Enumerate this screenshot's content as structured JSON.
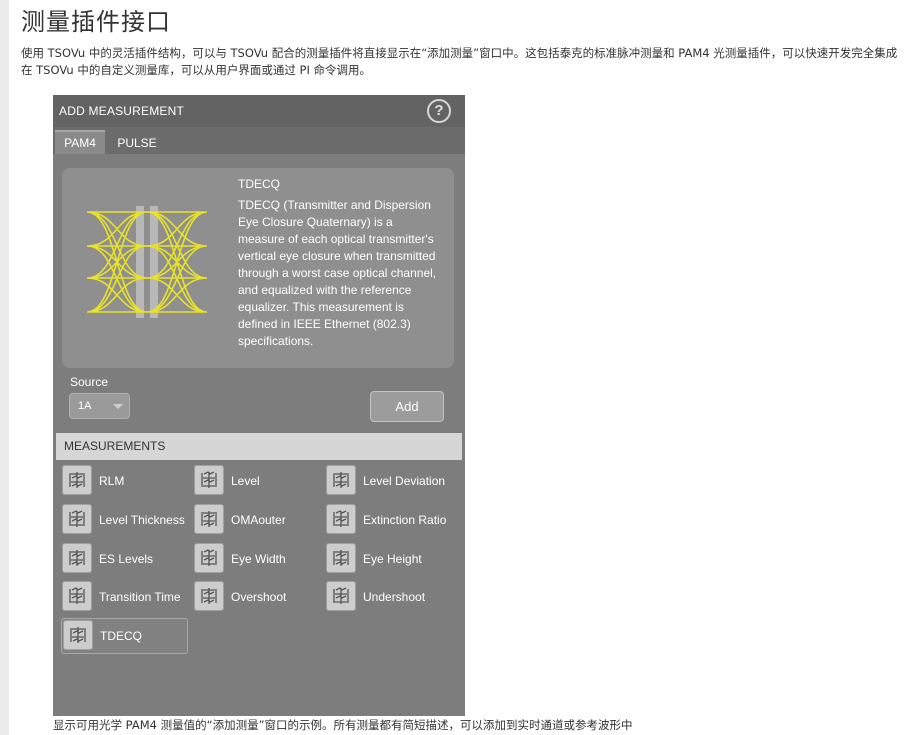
{
  "page": {
    "title": "测量插件接口",
    "intro": "使用 TSOVu 中的灵活插件结构，可以与 TSOVu 配合的测量插件将直接显示在“添加测量”窗口中。这包括泰克的标准脉冲测量和 PAM4 光测量插件，可以快速开发完全集成在 TSOVu 中的自定义测量库，可以从用户界面或通过 PI 命令调用。",
    "caption": "显示可用光学 PAM4 测量值的“添加测量”窗口的示例。所有测量都有简短描述，可以添加到实时通道或参考波形中"
  },
  "dialog": {
    "title": "ADD MEASUREMENT",
    "help_icon": "?",
    "tabs": [
      {
        "label": "PAM4",
        "active": true
      },
      {
        "label": "PULSE",
        "active": false
      }
    ],
    "description": {
      "title": "TDECQ",
      "text": "TDECQ (Transmitter and Dispersion Eye Closure Quaternary) is a measure of each optical transmitter's vertical eye closure when transmitted through a worst case optical channel, and equalized with the reference equalizer. This measurement is defined in IEEE Ethernet (802.3) specifications."
    },
    "source": {
      "label": "Source",
      "value": "1A"
    },
    "add_label": "Add",
    "measurements_header": "MEASUREMENTS",
    "measurements": [
      {
        "label": "RLM",
        "icon": "rlm-icon"
      },
      {
        "label": "Level",
        "icon": "level-icon"
      },
      {
        "label": "Level Deviation",
        "icon": "level-deviation-icon"
      },
      {
        "label": "Level Thickness",
        "icon": "level-thickness-icon"
      },
      {
        "label": "OMAouter",
        "icon": "omaouter-icon"
      },
      {
        "label": "Extinction Ratio",
        "icon": "extinction-ratio-icon"
      },
      {
        "label": "ES Levels",
        "icon": "es-levels-icon"
      },
      {
        "label": "Eye Width",
        "icon": "eye-width-icon"
      },
      {
        "label": "Eye Height",
        "icon": "eye-height-icon"
      },
      {
        "label": "Transition Time",
        "icon": "transition-time-icon"
      },
      {
        "label": "Overshoot",
        "icon": "overshoot-icon"
      },
      {
        "label": "Undershoot",
        "icon": "undershoot-icon"
      },
      {
        "label": "TDECQ",
        "icon": "tdecq-icon",
        "selected": true
      }
    ]
  },
  "colors": {
    "eye_trace": "#e8e22a",
    "dialog_bg": "#7d7d7d",
    "header_bg": "#636363"
  }
}
